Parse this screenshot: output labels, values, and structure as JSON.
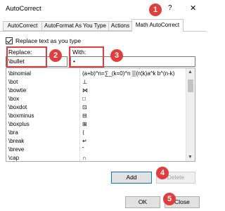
{
  "dialog": {
    "title": "AutoCorrect",
    "help_glyph": "?",
    "close_glyph": "✕"
  },
  "tabs": [
    {
      "label": "AutoCorrect"
    },
    {
      "label": "AutoFormat As You Type"
    },
    {
      "label": "Actions"
    },
    {
      "label": "Math AutoCorrect"
    }
  ],
  "options": {
    "replace_text_label": "Replace text as you type",
    "replace_text_checked": true
  },
  "form": {
    "replace_label": "Replace:",
    "replace_value": "\\bullet",
    "with_label": "With:",
    "with_value": "•"
  },
  "entries": [
    {
      "replace": "\\binomial",
      "with": "(a+b)^n=∑_(k=0)^n ▒(n¦k)a^k b^(n-k)"
    },
    {
      "replace": "\\bot",
      "with": "⊥"
    },
    {
      "replace": "\\bowtie",
      "with": "⋈"
    },
    {
      "replace": "\\box",
      "with": "□"
    },
    {
      "replace": "\\boxdot",
      "with": "⊡"
    },
    {
      "replace": "\\boxminus",
      "with": "⊟"
    },
    {
      "replace": "\\boxplus",
      "with": "⊞"
    },
    {
      "replace": "\\bra",
      "with": "⟨"
    },
    {
      "replace": "\\break",
      "with": "↵"
    },
    {
      "replace": "\\breve",
      "with": "˘"
    },
    {
      "replace": "\\cap",
      "with": "∩"
    }
  ],
  "buttons": {
    "add": "Add",
    "delete": "Delete",
    "ok": "OK",
    "close": "Close"
  },
  "markers": [
    "1",
    "2",
    "3",
    "4",
    "5"
  ],
  "colors": {
    "marker": "#e23c3c",
    "default_button_border": "#0078d7"
  }
}
